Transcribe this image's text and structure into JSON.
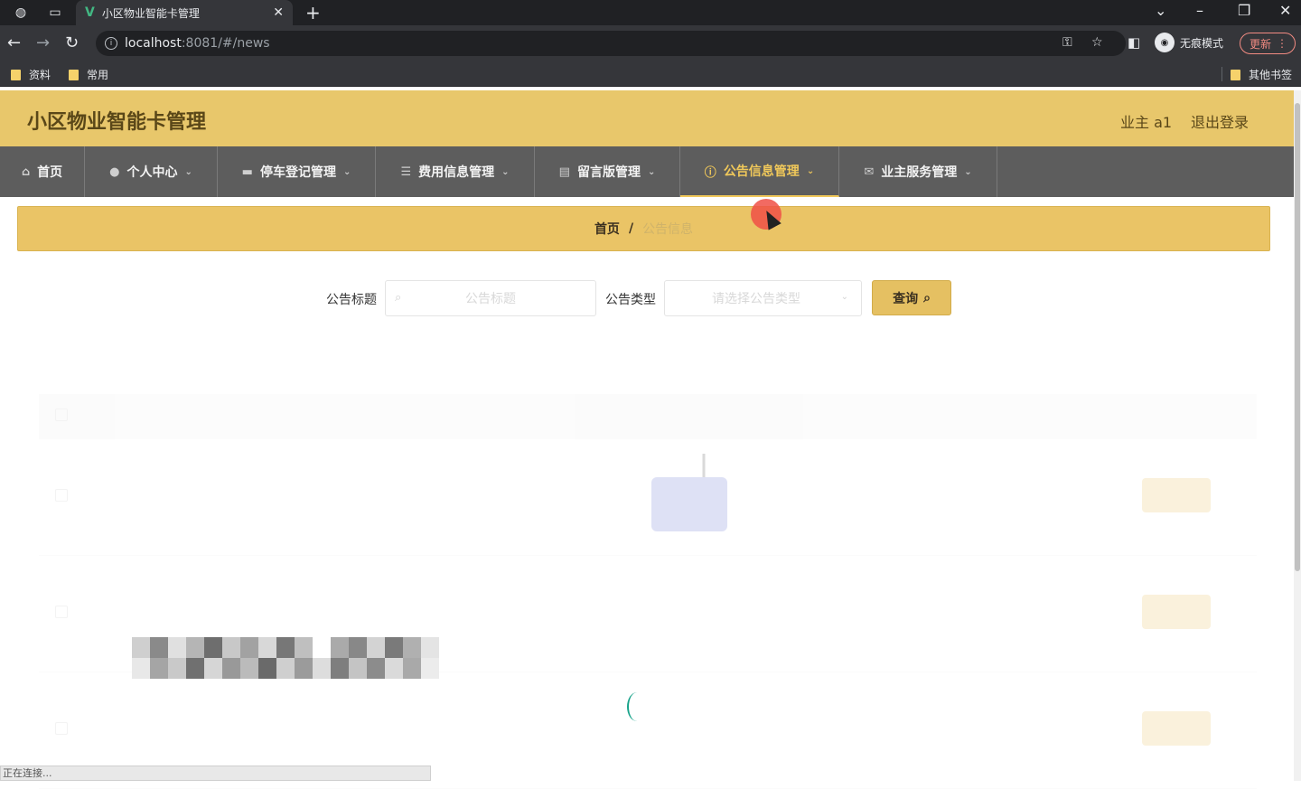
{
  "browser": {
    "tab_title": "小区物业智能卡管理",
    "url_host": "localhost",
    "url_rest": ":8081/#/news",
    "incognito_label": "无痕模式",
    "update_label": "更新",
    "bookmarks": [
      "资料",
      "常用"
    ],
    "other_bookmarks": "其他书签"
  },
  "header": {
    "title": "小区物业智能卡管理",
    "user": "业主 a1",
    "logout": "退出登录"
  },
  "nav": {
    "items": [
      {
        "label": "首页",
        "icon": "home-icon"
      },
      {
        "label": "个人中心",
        "icon": "user-icon"
      },
      {
        "label": "停车登记管理",
        "icon": "briefcase-icon"
      },
      {
        "label": "费用信息管理",
        "icon": "list-icon"
      },
      {
        "label": "留言版管理",
        "icon": "clipboard-icon"
      },
      {
        "label": "公告信息管理",
        "icon": "info-icon",
        "active": true
      },
      {
        "label": "业主服务管理",
        "icon": "mail-icon"
      }
    ]
  },
  "breadcrumb": {
    "home": "首页",
    "separator": "/",
    "current": "公告信息"
  },
  "search": {
    "title_label": "公告标题",
    "title_placeholder": "公告标题",
    "type_label": "公告类型",
    "type_placeholder": "请选择公告类型",
    "query_label": "查询"
  },
  "status_bar": "正在连接...",
  "colors": {
    "header_bg": "#e8c76b",
    "nav_bg": "#5d5d5d",
    "accent": "#f0c85a"
  }
}
